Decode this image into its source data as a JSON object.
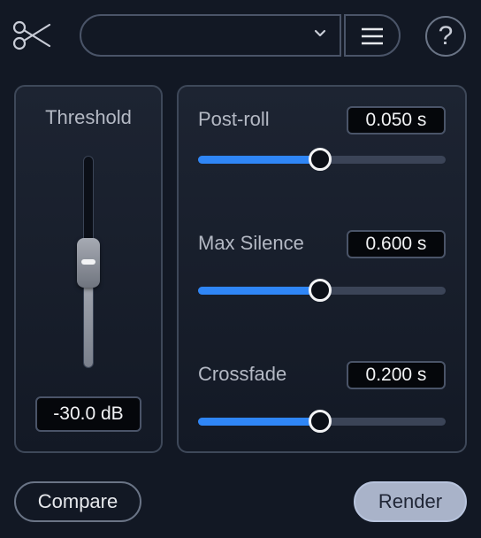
{
  "header": {
    "logo_icon": "scissors-icon",
    "preset_value": "",
    "preset_icon": "chevron-down-icon",
    "menu_icon": "hamburger-menu-icon",
    "help_label": "?"
  },
  "threshold": {
    "label": "Threshold",
    "value": "-30.0 dB",
    "slider_fraction": 0.52
  },
  "params": [
    {
      "label": "Post-roll",
      "value": "0.050 s",
      "fraction": 0.495
    },
    {
      "label": "Max Silence",
      "value": "0.600 s",
      "fraction": 0.495
    },
    {
      "label": "Crossfade",
      "value": "0.200 s",
      "fraction": 0.495
    }
  ],
  "buttons": {
    "compare": "Compare",
    "render": "Render"
  },
  "colors": {
    "background": "#121824",
    "accent": "#2f86f6",
    "render_button": "#a9b3c9"
  }
}
